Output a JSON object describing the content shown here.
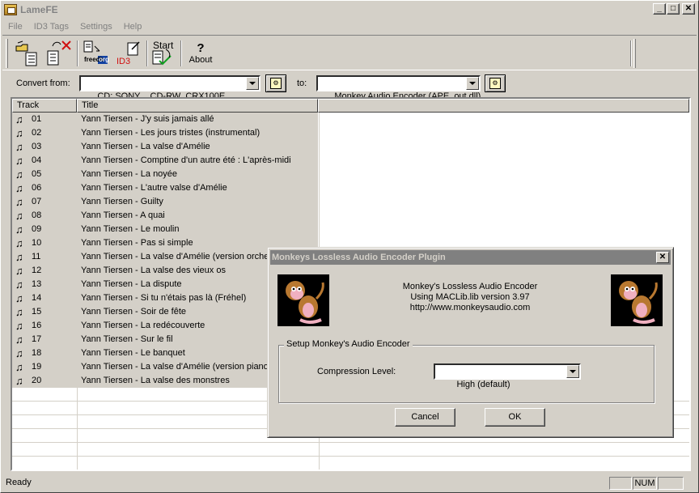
{
  "window": {
    "title": "LameFE"
  },
  "menu": [
    "File",
    "ID3 Tags",
    "Settings",
    "Help"
  ],
  "toolbar": {
    "freedb_label": "freedb",
    "org_label": "org",
    "id3_label": "ID3",
    "start_label": "Start",
    "about_label": "About"
  },
  "convert": {
    "from_label": "Convert from:",
    "from_value": "CD: SONY    CD-RW  CRX100E",
    "to_label": "to:",
    "to_value": "Monkey Audio Encoder (APE_out.dll)"
  },
  "list": {
    "col_track": "Track",
    "col_title": "Title",
    "rows": [
      {
        "track": "01",
        "title": "Yann Tiersen - J'y suis jamais allé"
      },
      {
        "track": "02",
        "title": "Yann Tiersen - Les jours tristes (instrumental)"
      },
      {
        "track": "03",
        "title": "Yann Tiersen - La valse d'Amélie"
      },
      {
        "track": "04",
        "title": "Yann Tiersen - Comptine d'un autre été : L'après-midi"
      },
      {
        "track": "05",
        "title": "Yann Tiersen - La noyée"
      },
      {
        "track": "06",
        "title": "Yann Tiersen - L'autre valse d'Amélie"
      },
      {
        "track": "07",
        "title": "Yann Tiersen - Guilty"
      },
      {
        "track": "08",
        "title": "Yann Tiersen - A quai"
      },
      {
        "track": "09",
        "title": "Yann Tiersen - Le moulin"
      },
      {
        "track": "10",
        "title": "Yann Tiersen - Pas si simple"
      },
      {
        "track": "11",
        "title": "Yann Tiersen - La valse d'Amélie (version orches"
      },
      {
        "track": "12",
        "title": "Yann Tiersen - La valse des vieux os"
      },
      {
        "track": "13",
        "title": "Yann Tiersen - La dispute"
      },
      {
        "track": "14",
        "title": "Yann Tiersen - Si tu n'étais pas là (Fréhel)"
      },
      {
        "track": "15",
        "title": "Yann Tiersen - Soir de fête"
      },
      {
        "track": "16",
        "title": "Yann Tiersen - La redécouverte"
      },
      {
        "track": "17",
        "title": "Yann Tiersen - Sur le fil"
      },
      {
        "track": "18",
        "title": "Yann Tiersen - Le banquet"
      },
      {
        "track": "19",
        "title": "Yann Tiersen - La valse d'Amélie (version piano)"
      },
      {
        "track": "20",
        "title": "Yann Tiersen - La valse des monstres"
      }
    ]
  },
  "status": {
    "text": "Ready",
    "num": "NUM"
  },
  "dialog": {
    "title": "Monkeys Lossless Audio Encoder Plugin",
    "close_glyph": "✕",
    "info_line1": "Monkey's Lossless Audio Encoder",
    "info_line2": "Using MACLib.lib version 3.97",
    "info_line3": "http://www.monkeysaudio.com",
    "group_label": "Setup Monkey's Audio Encoder",
    "level_label": "Compression Level:",
    "level_value": "High (default)",
    "cancel_label": "Cancel",
    "ok_label": "OK"
  }
}
